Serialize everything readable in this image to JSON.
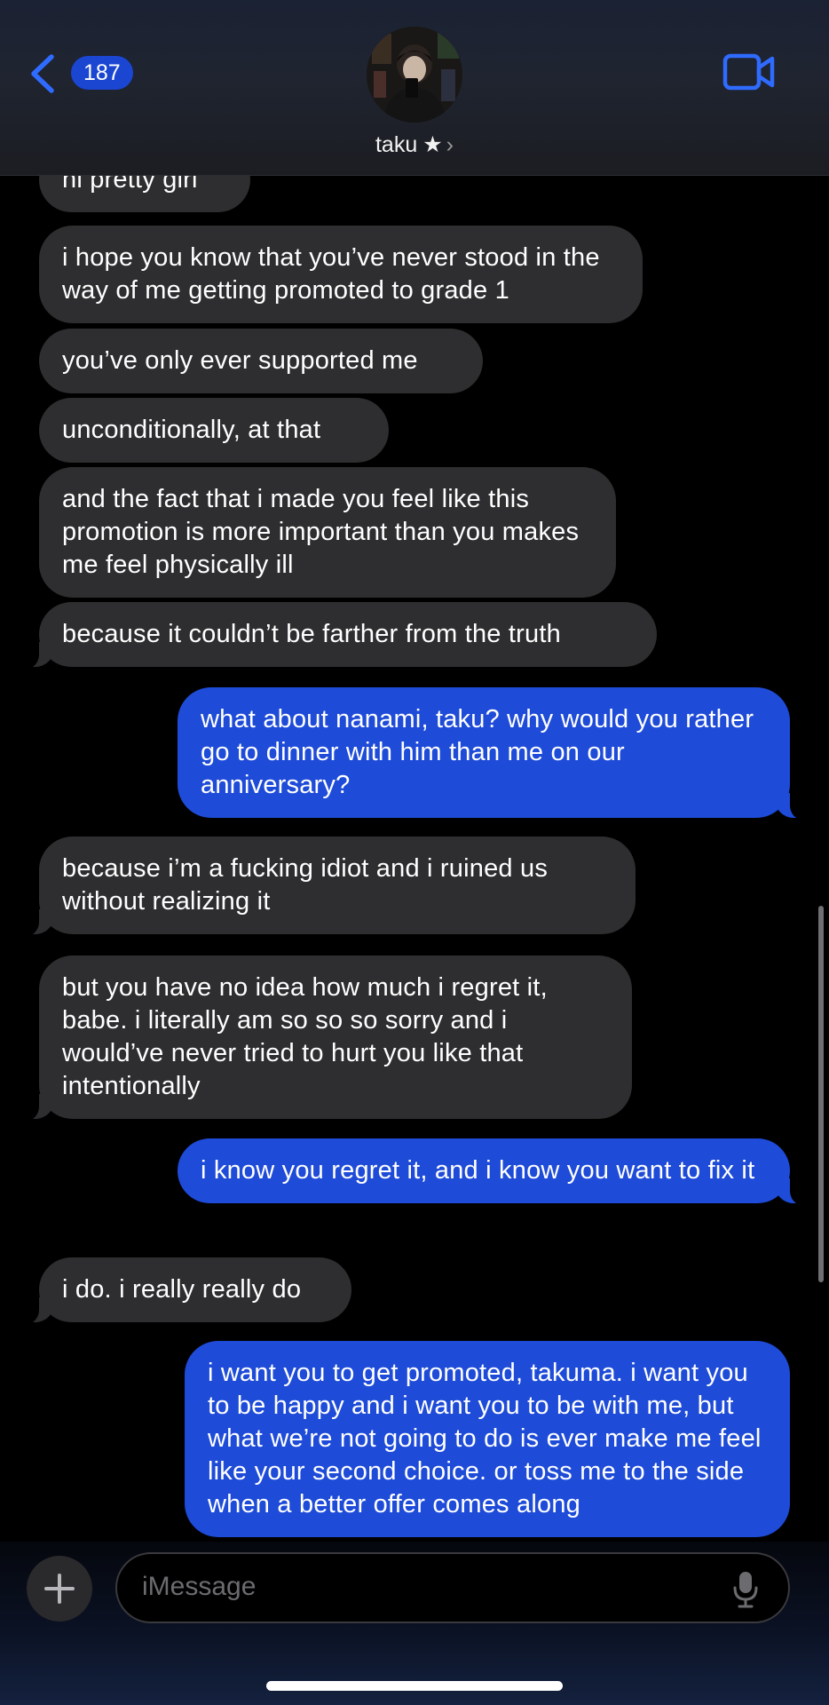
{
  "header": {
    "back_count": "187",
    "contact_name": "taku",
    "star": "★",
    "chevron": "›"
  },
  "messages": [
    {
      "side": "received",
      "text": "hi pretty girl"
    },
    {
      "side": "received",
      "text": "i hope you know that you’ve never stood in the way of me getting promoted to grade 1"
    },
    {
      "side": "received",
      "text": "you’ve only ever supported me"
    },
    {
      "side": "received",
      "text": "unconditionally, at that"
    },
    {
      "side": "received",
      "text": "and the fact that i made you feel like this promotion is more important than you makes me feel physically ill"
    },
    {
      "side": "received",
      "text": "because it couldn’t be farther from the truth"
    },
    {
      "side": "sent",
      "text": "what about nanami, taku? why would you rather go to dinner with him than me on our anniversary?"
    },
    {
      "side": "received",
      "text": "because i’m a fucking idiot and i ruined us without realizing it"
    },
    {
      "side": "received",
      "text": "but you have no idea how much i regret it, babe. i literally am so so so sorry and i would’ve never tried to hurt you like that intentionally"
    },
    {
      "side": "sent",
      "text": "i know you regret it, and i know you want to fix it"
    },
    {
      "side": "received",
      "text": "i do. i really really do"
    },
    {
      "side": "sent",
      "text": "i want you to get promoted, takuma. i want you to be happy and i want you to be with me, but what we’re not going to do is ever make me feel like your second choice. or toss me to the side when a better offer comes along"
    }
  ],
  "composer": {
    "placeholder": "iMessage"
  },
  "colors": {
    "sent_bubble": "#1e4bd8",
    "received_bubble": "#2e2e30",
    "accent": "#2f6bff"
  },
  "icons": {
    "back": "chevron-left-icon",
    "video": "video-camera-icon",
    "add": "plus-icon",
    "mic": "microphone-icon"
  }
}
